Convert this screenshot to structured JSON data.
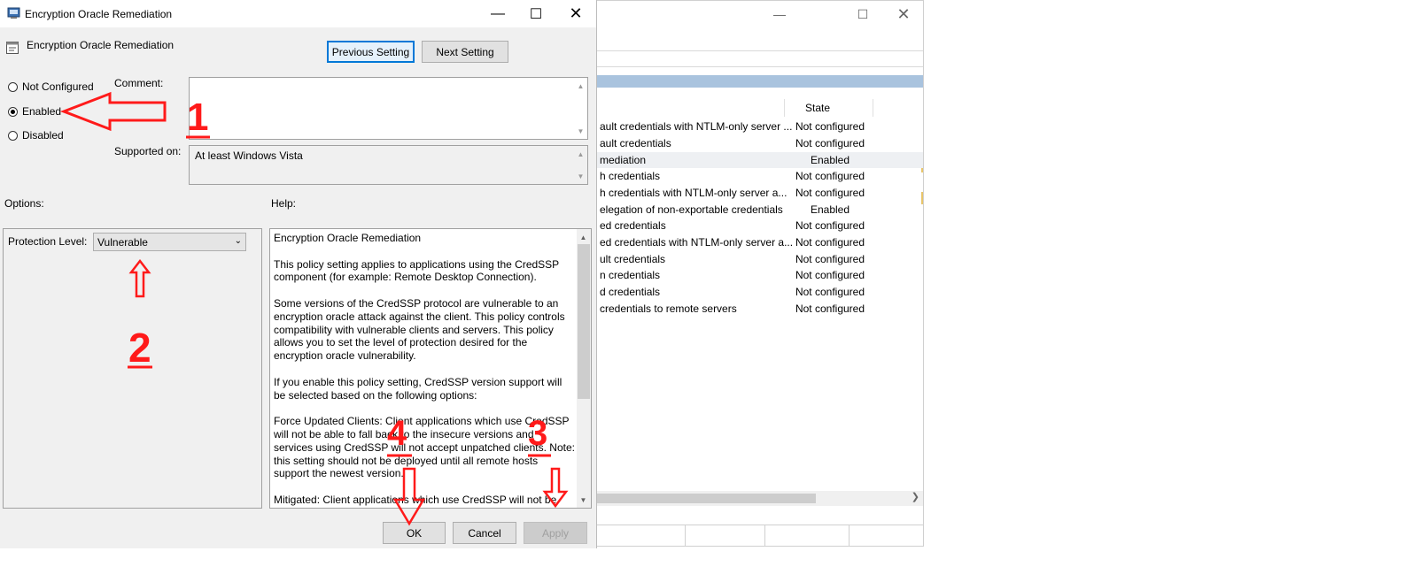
{
  "dialog": {
    "title": "Encryption Oracle Remediation",
    "policy_name": "Encryption Oracle Remediation",
    "buttons": {
      "previous": "Previous Setting",
      "next": "Next Setting",
      "ok": "OK",
      "cancel": "Cancel",
      "apply": "Apply"
    },
    "radios": [
      {
        "label": "Not Configured",
        "selected": false
      },
      {
        "label": "Enabled",
        "selected": true
      },
      {
        "label": "Disabled",
        "selected": false
      }
    ],
    "comment_label": "Comment:",
    "supported_label": "Supported on:",
    "supported_value": "At least Windows Vista",
    "options_label": "Options:",
    "help_label": "Help:",
    "protection_label": "Protection Level:",
    "protection_value": "Vulnerable",
    "help_paragraphs": [
      "Encryption Oracle Remediation",
      "This policy setting applies to applications using the CredSSP component (for example: Remote Desktop Connection).",
      "Some versions of the CredSSP protocol are vulnerable to an encryption oracle attack against the client.  This policy controls compatibility with vulnerable clients and servers.  This policy allows you to set the level of protection desired for the encryption oracle vulnerability.",
      "If you enable this policy setting, CredSSP version support will be selected based on the following options:",
      "Force Updated Clients: Client applications which use CredSSP will not be able to fall back to the insecure versions and services using CredSSP will not accept unpatched clients. Note: this setting should not be deployed until all remote hosts support the newest version.",
      "Mitigated: Client applications which use CredSSP will not be able"
    ]
  },
  "background_list": {
    "state_header": "State",
    "rows": [
      {
        "name": "ault credentials with NTLM-only server ...",
        "state": "Not configured"
      },
      {
        "name": "ault credentials",
        "state": "Not configured"
      },
      {
        "name": "mediation",
        "state": "Enabled"
      },
      {
        "name": "h credentials",
        "state": "Not configured"
      },
      {
        "name": "h credentials with NTLM-only server a...",
        "state": "Not configured"
      },
      {
        "name": "elegation of non-exportable credentials",
        "state": "Enabled"
      },
      {
        "name": "ed credentials",
        "state": "Not configured"
      },
      {
        "name": "ed credentials with NTLM-only server a...",
        "state": "Not configured"
      },
      {
        "name": "ult credentials",
        "state": "Not configured"
      },
      {
        "name": "n credentials",
        "state": "Not configured"
      },
      {
        "name": "d credentials",
        "state": "Not configured"
      },
      {
        "name": " credentials to remote servers",
        "state": "Not configured"
      }
    ]
  },
  "annotations": [
    "1",
    "2",
    "3",
    "4"
  ],
  "colors": {
    "annotation": "#ff1a1a",
    "focus": "#0078d7"
  }
}
